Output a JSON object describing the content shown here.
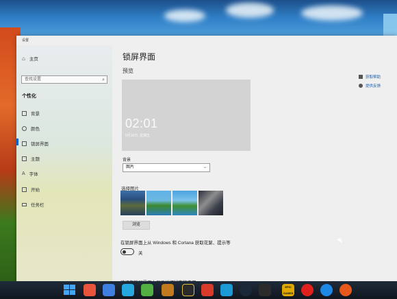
{
  "window": {
    "title": "设置"
  },
  "sidebar": {
    "home_label": "主页",
    "search_placeholder": "查找设置",
    "group_title": "个性化",
    "items": [
      {
        "label": "背景",
        "icon": "image-icon"
      },
      {
        "label": "颜色",
        "icon": "palette-icon"
      },
      {
        "label": "锁屏界面",
        "icon": "lockscreen-icon"
      },
      {
        "label": "主题",
        "icon": "brush-icon"
      },
      {
        "label": "字体",
        "icon": "font-icon"
      },
      {
        "label": "开始",
        "icon": "start-icon"
      },
      {
        "label": "任务栏",
        "icon": "taskbar-icon"
      }
    ],
    "active_index": 2
  },
  "content": {
    "page_title": "锁屏界面",
    "preview_heading": "预览",
    "preview_time": "02:01",
    "preview_date": "9月10日, 星期五",
    "background_label": "背景",
    "background_value": "图片",
    "choose_picture_label": "选择图片",
    "browse_button": "浏览",
    "toggle_label": "在锁屏界面上从 Windows 和 Cortana 获取花絮、提示等",
    "toggle_state": "关",
    "detail_label": "选择在锁屏界面上显示详细状态的应用"
  },
  "related": {
    "links": [
      "获取帮助",
      "提供反馈"
    ]
  },
  "taskbar": {
    "apps": [
      "windows-start-icon",
      "app-icon-1",
      "app-icon-2",
      "app-icon-3",
      "chat-icon",
      "app-icon-5",
      "app-icon-6",
      "app-icon-7",
      "app-icon-8",
      "steam-icon",
      "app-icon-10",
      "app-icon-11",
      "app-icon-12",
      "epic-games-icon",
      "netease-music-icon",
      "k-app-icon",
      "app-icon-16"
    ],
    "epic_label": "EPIC GAMES"
  },
  "colors": {
    "accent": "#0a64c8",
    "taskbar": "#11161f",
    "window_bg": "#efefef"
  }
}
